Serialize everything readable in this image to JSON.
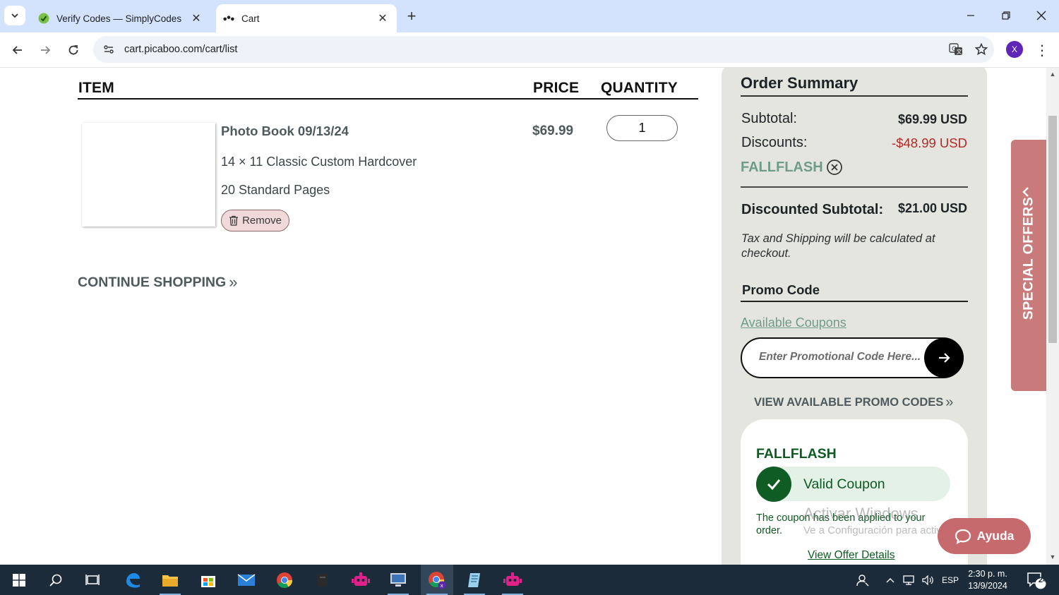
{
  "browser": {
    "tabs": [
      {
        "title": "Verify Codes — SimplyCodes",
        "favicon": "simplycodes-icon",
        "active": false
      },
      {
        "title": "Cart",
        "favicon": "picaboo-icon",
        "active": true
      }
    ],
    "url": "cart.picaboo.com/cart/list",
    "profile_initial": "X"
  },
  "cart": {
    "headers": {
      "item": "ITEM",
      "price": "PRICE",
      "quantity": "QUANTITY"
    },
    "item": {
      "title": "Photo Book 09/13/24",
      "size": "14 × 11 Classic Custom Hardcover",
      "pages": "20 Standard Pages",
      "remove_label": "Remove",
      "price": "$69.99",
      "quantity": "1"
    },
    "continue_label": "CONTINUE SHOPPING"
  },
  "summary": {
    "title": "Order Summary",
    "subtotal_label": "Subtotal:",
    "subtotal_value": "$69.99 USD",
    "discounts_label": "Discounts:",
    "discounts_value": "-$48.99 USD",
    "applied_code": "FALLFLASH",
    "discounted_subtotal_label": "Discounted Subtotal:",
    "discounted_subtotal_value": "$21.00 USD",
    "tax_note": "Tax and Shipping will be calculated at checkout.",
    "promo_heading": "Promo Code",
    "available_coupons_link": "Available Coupons",
    "promo_placeholder": "Enter Promotional Code Here...",
    "view_codes_label": "VIEW AVAILABLE PROMO CODES",
    "coupon_card": {
      "code": "FALLFLASH",
      "status": "Valid Coupon",
      "message": "The coupon has been applied to your order.",
      "details_link": "View Offer Details"
    }
  },
  "special_offers_label": "SPECIAL OFFERS",
  "help_label": "Ayuda",
  "watermark": {
    "line1": "Activar Windows",
    "line2": "Ve a Configuración para activar Windows."
  },
  "taskbar": {
    "language": "ESP",
    "time": "2:30 p. m.",
    "date": "13/9/2024",
    "notifications": "24"
  },
  "colors": {
    "accent_green": "#6e9c8a",
    "discount_red": "#b22a2a",
    "valid_green": "#0e5a22",
    "special_offers_bg": "#c97b7b",
    "summary_bg": "#e4e5df"
  }
}
